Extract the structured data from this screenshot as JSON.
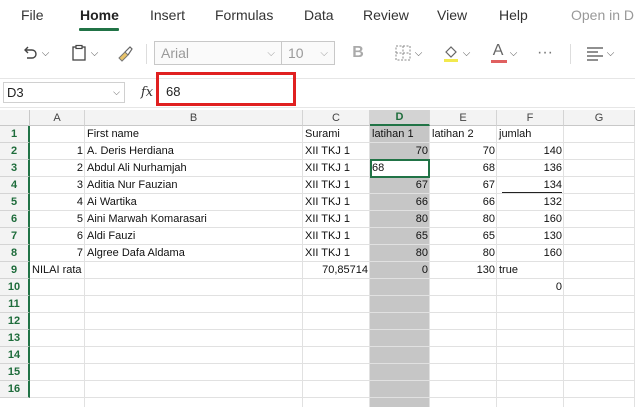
{
  "menu": {
    "items": [
      "File",
      "Home",
      "Insert",
      "Formulas",
      "Data",
      "Review",
      "View",
      "Help",
      "Open in D"
    ],
    "active": "Home"
  },
  "toolbar": {
    "font_name": "Arial",
    "font_size": "10",
    "bold": "B",
    "font_color_letter": "A",
    "more": "···"
  },
  "formula_bar": {
    "name_box": "D3",
    "fx_label": "fx",
    "value": "68"
  },
  "columns": [
    "A",
    "B",
    "C",
    "D",
    "E",
    "F",
    "G"
  ],
  "selected_column": "D",
  "rows": [
    "1",
    "2",
    "3",
    "4",
    "5",
    "6",
    "7",
    "8",
    "9",
    "10",
    "11",
    "12",
    "13",
    "14",
    "15",
    "16"
  ],
  "cells": {
    "B1": "First name",
    "C1": "Surami",
    "D1": "latihan 1",
    "E1": "latihan 2",
    "F1": "jumlah",
    "A2": "1",
    "B2": "A. Deris Herdiana",
    "C2": "XII TKJ 1",
    "D2": "70",
    "E2": "70",
    "F2": "140",
    "A3": "2",
    "B3": "Abdul Ali Nurhamjah",
    "C3": "XII TKJ 1",
    "D3": "68",
    "E3": "68",
    "F3": "136",
    "A4": "3",
    "B4": "Aditia Nur Fauzian",
    "C4": "XII TKJ 1",
    "D4": "67",
    "E4": "67",
    "F4": "134",
    "A5": "4",
    "B5": "Ai Wartika",
    "C5": "XII TKJ 1",
    "D5": "66",
    "E5": "66",
    "F5": "132",
    "A6": "5",
    "B6": "Aini Marwah Komarasari",
    "C6": "XII TKJ 1",
    "D6": "80",
    "E6": "80",
    "F6": "160",
    "A7": "6",
    "B7": "Aldi Fauzi",
    "C7": "XII TKJ 1",
    "D7": "65",
    "E7": "65",
    "F7": "130",
    "A8": "7",
    "B8": "Algree Dafa Aldama",
    "C8": "XII TKJ 1",
    "D8": "80",
    "E8": "80",
    "F8": "160",
    "A9": "NILAI rata",
    "C9": "70,85714",
    "D9": "0",
    "E9": "130",
    "F9": "true",
    "F10": "0"
  },
  "colors": {
    "accent": "#217346",
    "highlight_box": "#e02020",
    "selected_column_fill": "#c6c6c6"
  }
}
